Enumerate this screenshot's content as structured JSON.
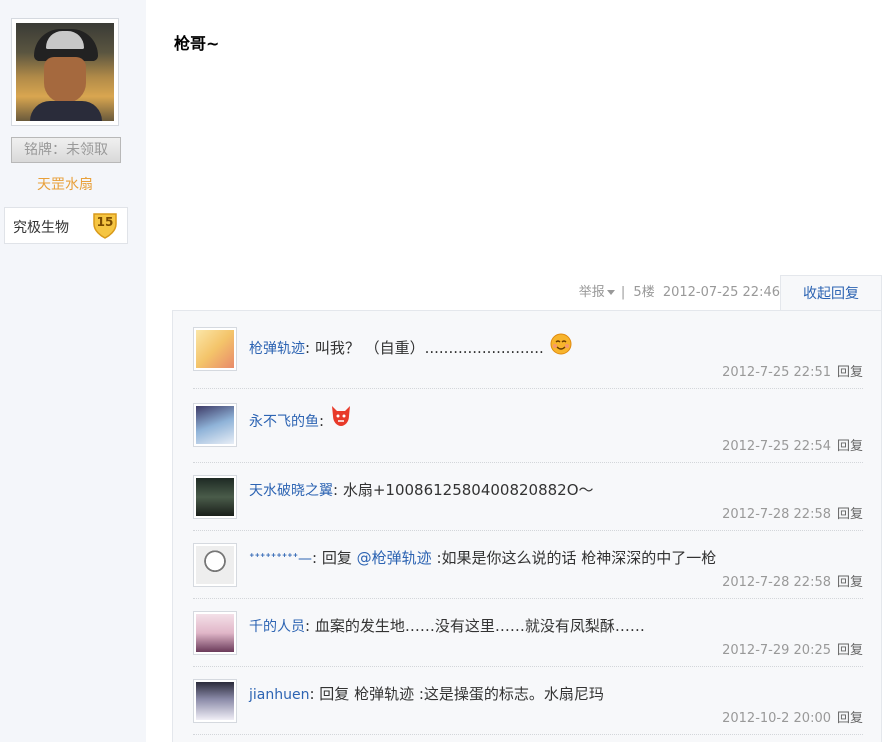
{
  "left": {
    "badge": "铭牌：未领取",
    "username": "天罡水扇",
    "level_name": "究极生物",
    "level": "15"
  },
  "post": {
    "title": "枪哥~",
    "report": "举报",
    "separator": "|",
    "floor": "5楼",
    "datetime": "2012-07-25 22:46",
    "collapse": "收起回复"
  },
  "replies": [
    {
      "name": "枪弹轨迹",
      "sep": ":",
      "text": " 叫我？ （自重）.........................",
      "time": "2012-7-25 22:51",
      "reply": "回复"
    },
    {
      "name": "永不飞的鱼",
      "sep": ":",
      "text": "",
      "time": "2012-7-25 22:54",
      "reply": "回复"
    },
    {
      "name": "天水破晓之翼",
      "sep": ":",
      "text": " 水扇+1008612580400820882O～",
      "time": "2012-7-28 22:58",
      "reply": "回复"
    },
    {
      "name": "ᐩᐩᐩᐩᐩᐩᐩᐩᐩ—",
      "sep": ":",
      "pre": " 回复 ",
      "at": "@枪弹轨迹",
      "text": " :如果是你这么说的话 枪神深深的中了一枪",
      "time": "2012-7-28 22:58",
      "reply": "回复"
    },
    {
      "name": "千的人员",
      "sep": ":",
      "text": " 血案的发生地……没有这里……就没有凤梨酥……",
      "time": "2012-7-29 20:25",
      "reply": "回复"
    },
    {
      "name": "jianhuen",
      "sep": ":",
      "text": " 回复 枪弹轨迹 :这是操蛋的标志。水扇尼玛",
      "time": "2012-10-2 20:00",
      "reply": "回复"
    }
  ],
  "colors": {
    "link": "#2d64b3",
    "username": "#e8a03a"
  },
  "icons": [
    "report-caret-icon",
    "smile-emoji-icon",
    "fox-emoji-icon",
    "level-shield-icon"
  ]
}
